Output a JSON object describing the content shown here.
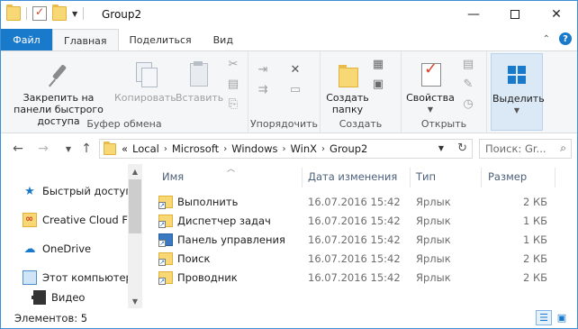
{
  "title_bar": {
    "title": "Group2",
    "minimize": "—",
    "close": "✕"
  },
  "tabs": {
    "file": "Файл",
    "home": "Главная",
    "share": "Поделиться",
    "view": "Вид"
  },
  "ribbon": {
    "clipboard": {
      "label": "Буфер обмена",
      "pin": "Закрепить на панели быстрого доступа",
      "copy": "Копировать",
      "paste": "Вставить"
    },
    "organize": {
      "label": "Упорядочить"
    },
    "create": {
      "label": "Создать",
      "new_folder": "Создать папку"
    },
    "open": {
      "label": "Открыть",
      "properties": "Свойства"
    },
    "select": {
      "select": "Выделить"
    }
  },
  "address_bar": {
    "overflow": "«",
    "crumbs": [
      "Local",
      "Microsoft",
      "Windows",
      "WinX",
      "Group2"
    ],
    "search_placeholder": "Поиск: Gr..."
  },
  "nav_pane": {
    "items": [
      {
        "label": "Быстрый доступ",
        "icon": "star-icon"
      },
      {
        "label": "Creative Cloud Files",
        "icon": "creative-cloud-icon"
      },
      {
        "label": "OneDrive",
        "icon": "onedrive-icon"
      },
      {
        "label": "Этот компьютер",
        "icon": "computer-icon"
      },
      {
        "label": "Видео",
        "icon": "video-icon"
      }
    ]
  },
  "file_list": {
    "columns": [
      "Имя",
      "Дата изменения",
      "Тип",
      "Размер"
    ],
    "rows": [
      {
        "name": "Выполнить",
        "date": "16.07.2016 15:42",
        "type": "Ярлык",
        "size": "2 КБ",
        "icon": "folder-shortcut-icon"
      },
      {
        "name": "Диспетчер задач",
        "date": "16.07.2016 15:42",
        "type": "Ярлык",
        "size": "1 КБ",
        "icon": "folder-shortcut-icon"
      },
      {
        "name": "Панель управления",
        "date": "16.07.2016 15:42",
        "type": "Ярлык",
        "size": "1 КБ",
        "icon": "control-panel-shortcut-icon"
      },
      {
        "name": "Поиск",
        "date": "16.07.2016 15:42",
        "type": "Ярлык",
        "size": "2 КБ",
        "icon": "folder-shortcut-icon"
      },
      {
        "name": "Проводник",
        "date": "16.07.2016 15:42",
        "type": "Ярлык",
        "size": "2 КБ",
        "icon": "folder-shortcut-icon"
      }
    ]
  },
  "status_bar": {
    "count": "Элементов: 5"
  },
  "colors": {
    "accent": "#1979ca",
    "ribbon_bg": "#f5f6f7",
    "header_text": "#4c607a"
  }
}
